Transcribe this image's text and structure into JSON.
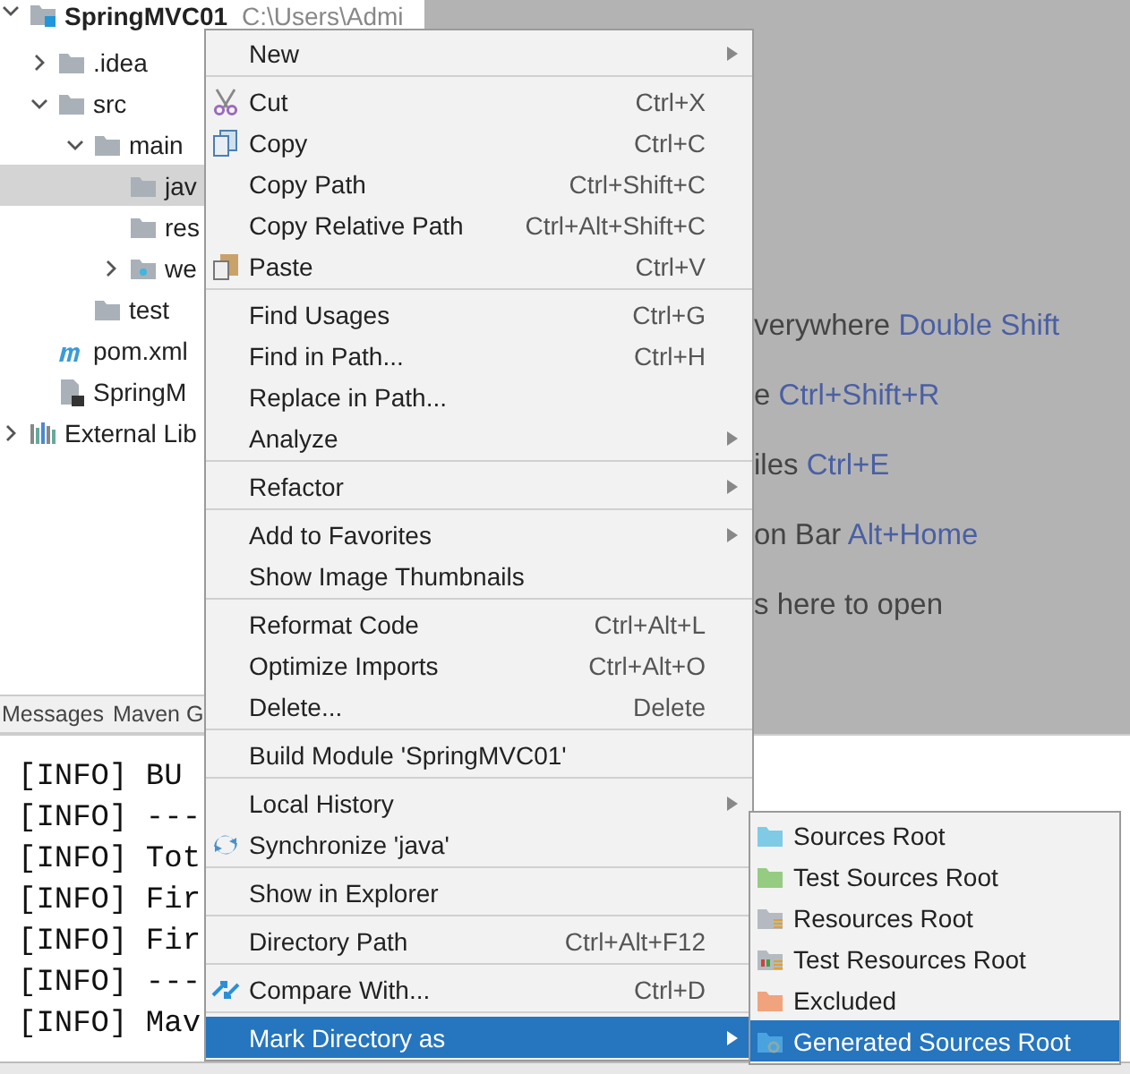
{
  "project_tree": {
    "items": [
      {
        "label": "SpringMVC01",
        "path": "C:\\Users\\Admi",
        "kind": "module",
        "expanded": true,
        "selected": false,
        "children": [
          {
            "label": ".idea",
            "kind": "folder",
            "expanded": false,
            "selected": false
          },
          {
            "label": "src",
            "kind": "folder",
            "expanded": true,
            "selected": false,
            "children": [
              {
                "label": "main",
                "kind": "folder",
                "expanded": true,
                "selected": false,
                "children": [
                  {
                    "label": "jav",
                    "kind": "folder",
                    "selected": true
                  },
                  {
                    "label": "res",
                    "kind": "folder",
                    "selected": false
                  },
                  {
                    "label": "we",
                    "kind": "web",
                    "expanded": false,
                    "selected": false
                  }
                ]
              },
              {
                "label": "test",
                "kind": "folder",
                "selected": false
              }
            ]
          },
          {
            "label": "pom.xml",
            "kind": "maven",
            "selected": false
          },
          {
            "label": "SpringM",
            "kind": "file",
            "selected": false
          }
        ]
      },
      {
        "label": "External Lib",
        "kind": "library",
        "expanded": false,
        "selected": false
      }
    ]
  },
  "editor_hints": [
    {
      "text": "verywhere",
      "shortcut": "Double Shift"
    },
    {
      "text": "e",
      "shortcut": "Ctrl+Shift+R"
    },
    {
      "text": "iles",
      "shortcut": "Ctrl+E"
    },
    {
      "text": "on Bar",
      "shortcut": "Alt+Home"
    },
    {
      "text": "s here to open"
    }
  ],
  "tool_tabs": [
    "Messages",
    "Maven G"
  ],
  "console_lines": [
    "[INFO] BU",
    "[INFO] ---",
    "[INFO] Tot",
    "[INFO] Fir",
    "[INFO] Fir",
    "[INFO] ---",
    "[INFO] Mav"
  ],
  "context_menu": {
    "items": [
      {
        "kind": "plain",
        "label": "New",
        "submenu": true,
        "selected": false
      },
      {
        "kind": "separator"
      },
      {
        "kind": "cut",
        "label": "Cut",
        "shortcut": "Ctrl+X",
        "selected": false
      },
      {
        "kind": "copy",
        "label": "Copy",
        "shortcut": "Ctrl+C",
        "selected": false
      },
      {
        "kind": "plain",
        "label": "Copy Path",
        "shortcut": "Ctrl+Shift+C",
        "selected": false
      },
      {
        "kind": "plain",
        "label": "Copy Relative Path",
        "shortcut": "Ctrl+Alt+Shift+C",
        "selected": false
      },
      {
        "kind": "paste",
        "label": "Paste",
        "shortcut": "Ctrl+V",
        "selected": false
      },
      {
        "kind": "separator"
      },
      {
        "kind": "plain",
        "label": "Find Usages",
        "shortcut": "Ctrl+G",
        "selected": false
      },
      {
        "kind": "plain",
        "label": "Find in Path...",
        "shortcut": "Ctrl+H",
        "selected": false
      },
      {
        "kind": "plain",
        "label": "Replace in Path...",
        "selected": false
      },
      {
        "kind": "plain",
        "label": "Analyze",
        "submenu": true,
        "selected": false
      },
      {
        "kind": "separator"
      },
      {
        "kind": "plain",
        "label": "Refactor",
        "submenu": true,
        "selected": false
      },
      {
        "kind": "separator"
      },
      {
        "kind": "plain",
        "label": "Add to Favorites",
        "submenu": true,
        "selected": false
      },
      {
        "kind": "plain",
        "label": "Show Image Thumbnails",
        "selected": false
      },
      {
        "kind": "separator"
      },
      {
        "kind": "plain",
        "label": "Reformat Code",
        "shortcut": "Ctrl+Alt+L",
        "selected": false
      },
      {
        "kind": "plain",
        "label": "Optimize Imports",
        "shortcut": "Ctrl+Alt+O",
        "selected": false
      },
      {
        "kind": "plain",
        "label": "Delete...",
        "shortcut": "Delete",
        "selected": false
      },
      {
        "kind": "separator"
      },
      {
        "kind": "plain",
        "label": "Build Module 'SpringMVC01'",
        "selected": false
      },
      {
        "kind": "separator"
      },
      {
        "kind": "plain",
        "label": "Local History",
        "submenu": true,
        "selected": false
      },
      {
        "kind": "sync",
        "label": "Synchronize 'java'",
        "selected": false
      },
      {
        "kind": "separator"
      },
      {
        "kind": "plain",
        "label": "Show in Explorer",
        "selected": false
      },
      {
        "kind": "separator"
      },
      {
        "kind": "plain",
        "label": "Directory Path",
        "shortcut": "Ctrl+Alt+F12",
        "selected": false
      },
      {
        "kind": "separator"
      },
      {
        "kind": "compare",
        "label": "Compare With...",
        "shortcut": "Ctrl+D",
        "selected": false
      },
      {
        "kind": "separator"
      },
      {
        "kind": "plain",
        "label": "Mark Directory as",
        "submenu": true,
        "selected": true
      }
    ]
  },
  "submenu": {
    "items": [
      {
        "label": "Sources Root",
        "kind": "sources",
        "selected": false
      },
      {
        "label": "Test Sources Root",
        "kind": "test-sources",
        "selected": false
      },
      {
        "label": "Resources Root",
        "kind": "resources",
        "selected": false
      },
      {
        "label": "Test Resources Root",
        "kind": "test-resources",
        "selected": false
      },
      {
        "label": "Excluded",
        "kind": "excluded",
        "selected": false
      },
      {
        "label": "Generated Sources Root",
        "kind": "generated",
        "selected": true
      }
    ]
  }
}
